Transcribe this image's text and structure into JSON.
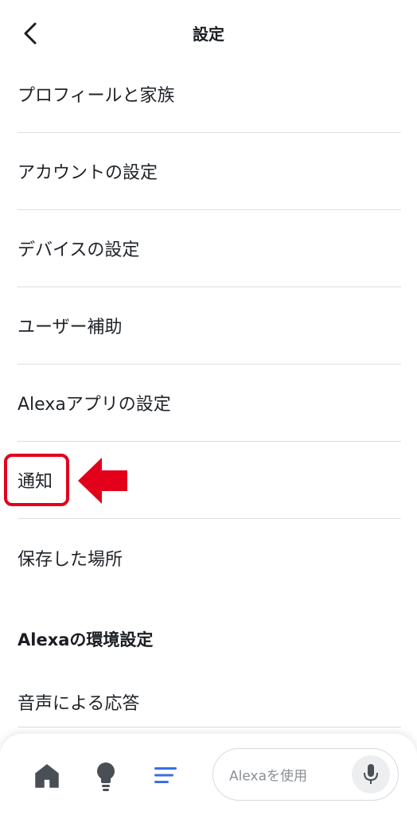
{
  "header": {
    "title": "設定",
    "back_icon": "chevron-left-icon"
  },
  "settings": {
    "items": [
      {
        "label": "プロフィールと家族"
      },
      {
        "label": "アカウントの設定"
      },
      {
        "label": "デバイスの設定"
      },
      {
        "label": "ユーザー補助"
      },
      {
        "label": "Alexaアプリの設定"
      },
      {
        "label": "通知"
      },
      {
        "label": "保存した場所"
      }
    ]
  },
  "annotation": {
    "highlight_color": "#e3001b",
    "highlighted_item": "通知"
  },
  "preferences": {
    "section_title": "Alexaの環境設定",
    "items": [
      {
        "label": "音声による応答"
      }
    ]
  },
  "bottom_nav": {
    "icons": [
      "home-icon",
      "lightbulb-icon",
      "menu-icon"
    ],
    "active": "menu-icon",
    "active_color": "#3a6ee8",
    "inactive_color": "#4a4f56",
    "alexa_placeholder": "Alexaを使用",
    "mic_icon": "microphone-icon"
  }
}
